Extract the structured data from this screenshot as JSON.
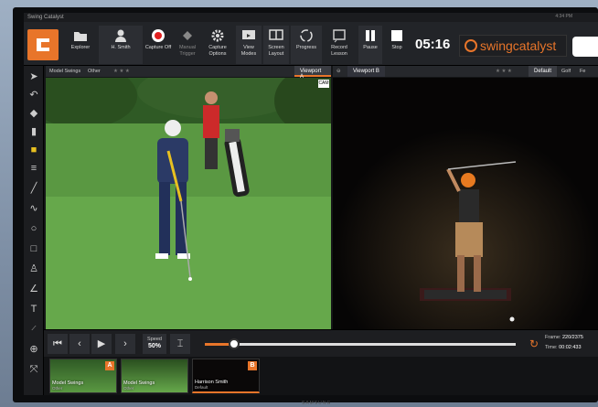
{
  "app": {
    "title": "Swing Catalyst",
    "clock": "4:34 PM",
    "monitor_brand": "SAMSUNG"
  },
  "toolbar": {
    "explorer": "Explorer",
    "user": "H. Smith",
    "capture_off": "Capture Off",
    "manual_trigger": "Manual Trigger",
    "capture_options": "Capture Options",
    "view_modes": "View Modes",
    "screen_layout": "Screen Layout",
    "progress": "Progress",
    "record_lesson": "Record Lesson",
    "pause": "Pause",
    "stop": "Stop",
    "timer": "05:16",
    "brand": "swingcatalyst"
  },
  "viewport_a": {
    "tab_model": "Model Swings",
    "tab_other": "Other",
    "stars": "★ ★ ★",
    "label": "Viewport A",
    "cam": "CAM"
  },
  "viewport_b": {
    "label": "Viewport B",
    "stars": "★ ★ ★",
    "mode": "Default",
    "sport": "Golf",
    "extra": "Fe"
  },
  "playback": {
    "speed_label": "Speed",
    "speed_value": "50%",
    "progress_fraction": 0.0928,
    "frame_label": "Frame:",
    "frame_value": "220/2375",
    "time_label": "Time:",
    "time_value": "00:02:433"
  },
  "thumbnails": [
    {
      "title": "Model Swings",
      "sub": "Other",
      "badge": "A"
    },
    {
      "title": "Model Swings",
      "sub": "Other",
      "badge": ""
    },
    {
      "title": "Harrison Smith",
      "sub": "Default",
      "badge": "B"
    }
  ],
  "colors": {
    "accent": "#e8752a",
    "grass": "#4e8a3a",
    "toolbar": "#222428"
  }
}
